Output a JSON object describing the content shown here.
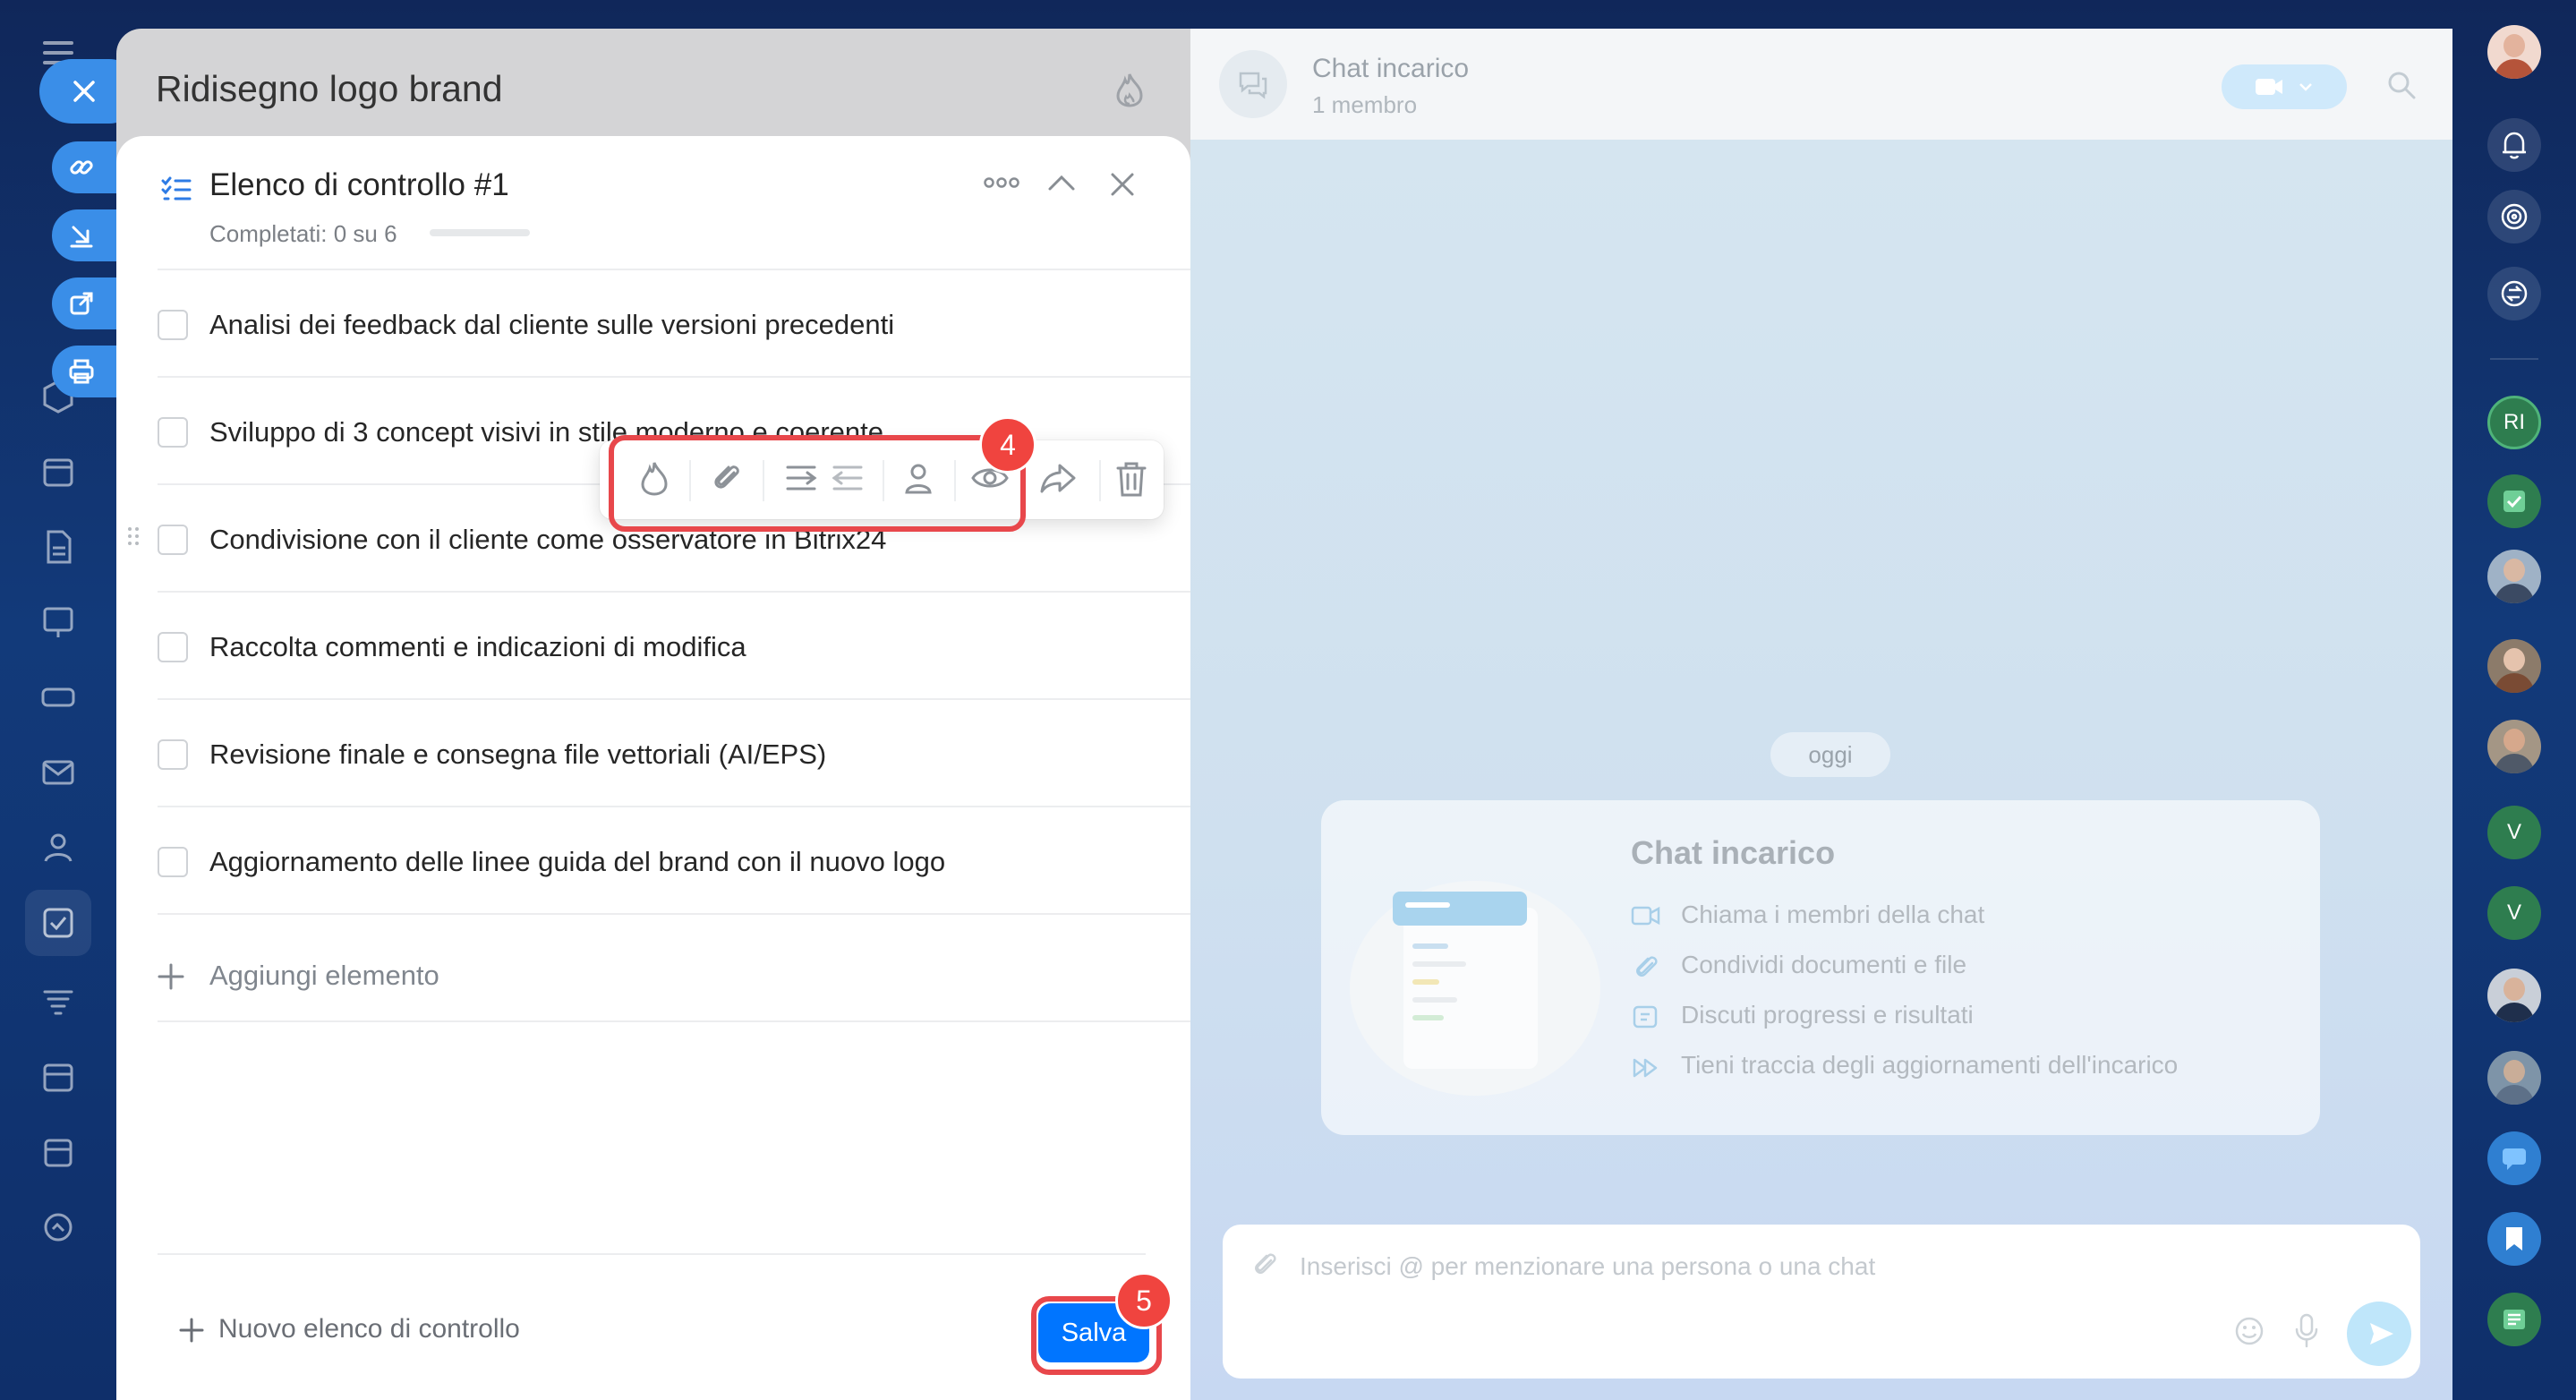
{
  "colors": {
    "accent": "#0075ff",
    "highlight": "#e8474b",
    "progress": "#2fc6f6",
    "rail_green": "#2e7d4f"
  },
  "slider": {
    "title": "Ridisegno logo brand",
    "header_icon": "flame-icon"
  },
  "checklist": {
    "title": "Elenco di controllo #1",
    "progress_text": "Completati: 0 su 6",
    "progress_fraction": 0,
    "items": [
      {
        "label": "Analisi dei feedback dal cliente sulle versioni precedenti",
        "checked": false
      },
      {
        "label": "Sviluppo di 3 concept visivi in stile moderno e coerente",
        "checked": false
      },
      {
        "label": "Condivisione con il cliente come osservatore in Bitrix24",
        "checked": false
      },
      {
        "label": "Raccolta commenti e indicazioni di modifica",
        "checked": false
      },
      {
        "label": "Revisione finale e consegna file vettoriali (AI/EPS)",
        "checked": false
      },
      {
        "label": "Aggiornamento delle linee guida del brand con il nuovo logo",
        "checked": false
      }
    ],
    "add_item_label": "Aggiungi elemento"
  },
  "toolbar": {
    "icons": [
      "flame-icon",
      "paperclip-icon",
      "indent-icon",
      "outdent-icon",
      "person-icon",
      "eye-icon",
      "forward-icon",
      "trash-icon"
    ],
    "badge_label": "4"
  },
  "footer": {
    "new_checklist_label": "Nuovo elenco di controllo",
    "save_label": "Salva",
    "save_badge": "5"
  },
  "chat": {
    "title": "Chat incarico",
    "members": "1 membro",
    "date_label": "oggi",
    "intro_title": "Chat incarico",
    "features": [
      {
        "icon": "video-icon",
        "label": "Chiama i membri della chat"
      },
      {
        "icon": "paperclip-icon",
        "label": "Condividi documenti e file"
      },
      {
        "icon": "chat-icon",
        "label": "Discuti progressi e risultati"
      },
      {
        "icon": "fast-forward-icon",
        "label": "Tieni traccia degli aggiornamenti dell'incarico"
      }
    ],
    "composer_placeholder": "Inserisci @ per menzionare una persona o una chat"
  },
  "right_rail": {
    "initials": [
      "RI",
      "V",
      "V"
    ]
  }
}
